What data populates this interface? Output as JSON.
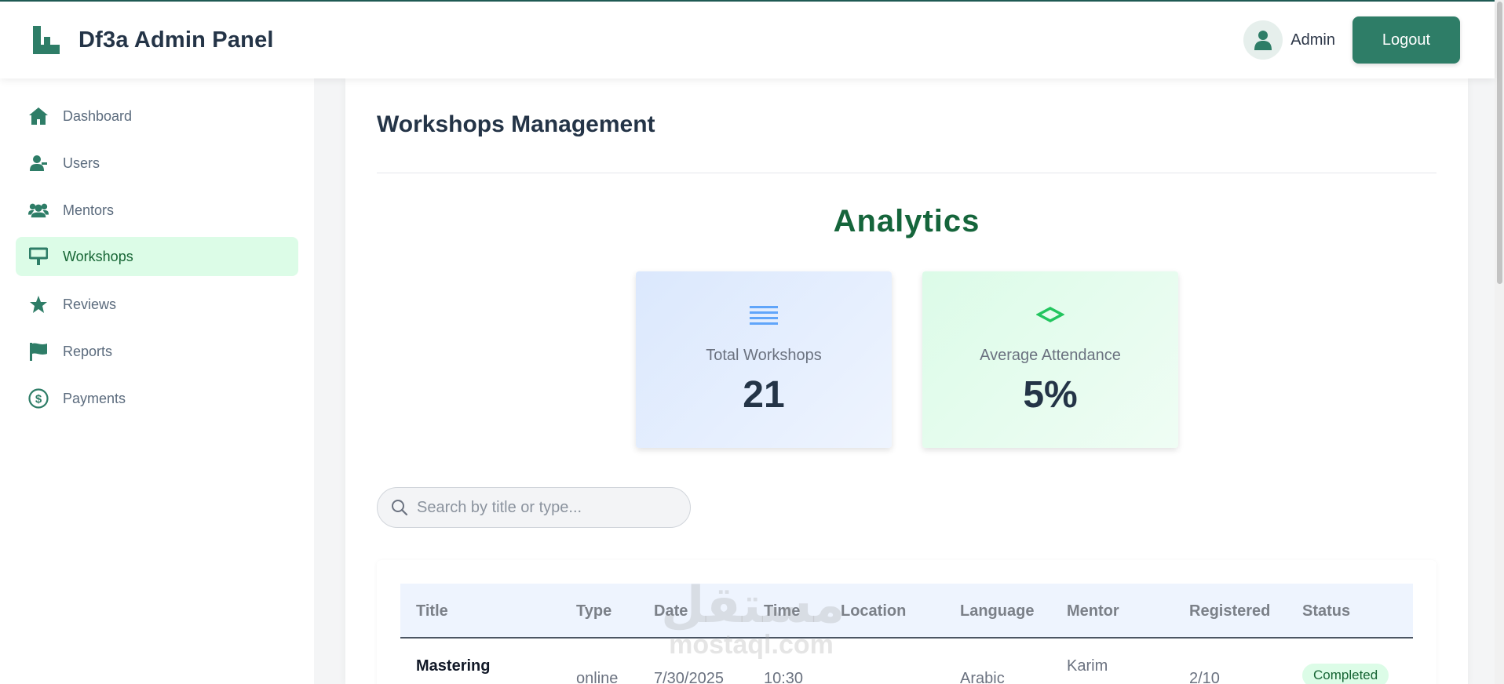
{
  "app": {
    "title": "Df3a Admin Panel"
  },
  "user": {
    "name": "Admin",
    "logout_label": "Logout"
  },
  "sidebar": {
    "items": [
      {
        "label": "Dashboard",
        "icon": "home-icon",
        "active": false
      },
      {
        "label": "Users",
        "icon": "users-icon",
        "active": false
      },
      {
        "label": "Mentors",
        "icon": "mentors-icon",
        "active": false
      },
      {
        "label": "Workshops",
        "icon": "workshop-board-icon",
        "active": true
      },
      {
        "label": "Reviews",
        "icon": "star-icon",
        "active": false
      },
      {
        "label": "Reports",
        "icon": "flag-icon",
        "active": false
      },
      {
        "label": "Payments",
        "icon": "dollar-icon",
        "active": false
      }
    ]
  },
  "page": {
    "title": "Workshops Management"
  },
  "analytics": {
    "title": "Analytics",
    "cards": [
      {
        "label": "Total Workshops",
        "value": "21",
        "icon": "list-icon"
      },
      {
        "label": "Average Attendance",
        "value": "5%",
        "icon": "diamond-icon"
      }
    ]
  },
  "search": {
    "placeholder": "Search by title or type...",
    "value": ""
  },
  "table": {
    "columns": [
      "Title",
      "Type",
      "Date",
      "Time",
      "Location",
      "Language",
      "Mentor",
      "Registered",
      "Status"
    ],
    "rows": [
      {
        "title": "Mastering",
        "type": "online",
        "date": "7/30/2025",
        "time": "10:30",
        "location": "",
        "language": "Arabic",
        "mentor": "Karim",
        "registered": "2/10",
        "status": "Completed"
      }
    ]
  },
  "watermark": {
    "arabic": "مستقل",
    "latin": "mostaql.com"
  },
  "colors": {
    "primary": "#2e7d67",
    "active_bg": "#dcfce7",
    "analytics_title": "#15653b"
  }
}
